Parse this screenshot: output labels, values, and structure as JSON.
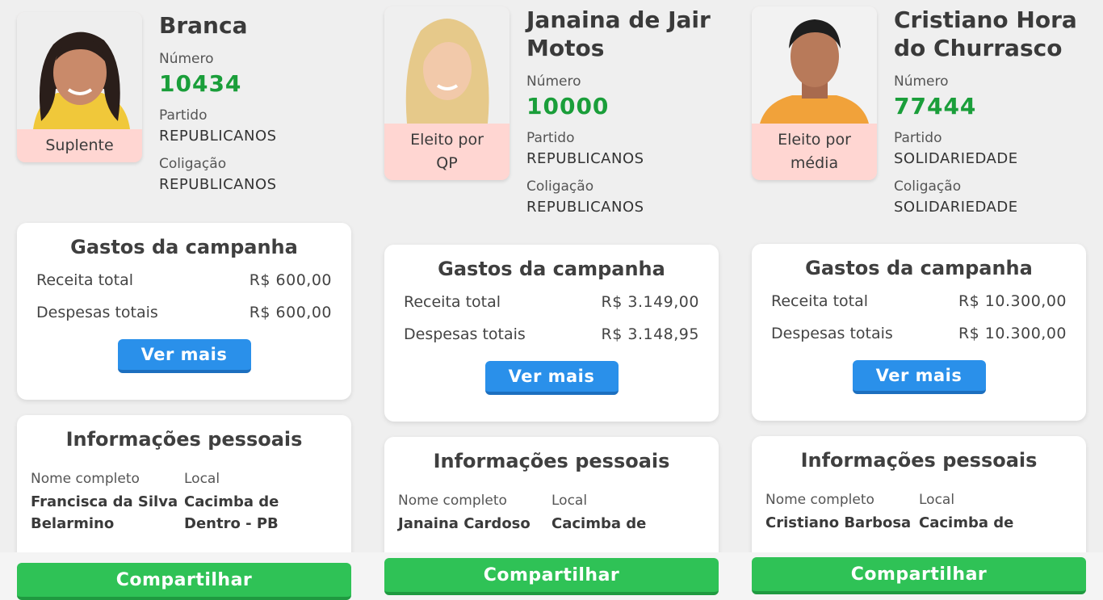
{
  "candidates": [
    {
      "name": "Branca",
      "status": "Suplente",
      "numero_label": "Número",
      "numero": "10434",
      "partido_label": "Partido",
      "partido": "REPUBLICANOS",
      "coligacao_label": "Coligação",
      "coligacao": "REPUBLICANOS",
      "gastos": {
        "title": "Gastos da campanha",
        "receita_label": "Receita total",
        "receita": "R$ 600,00",
        "despesas_label": "Despesas totais",
        "despesas": "R$ 600,00",
        "button": "Ver mais"
      },
      "pessoais": {
        "title": "Informações pessoais",
        "nome_label": "Nome completo",
        "nome": "Francisca da Silva\nBelarmino",
        "local_label": "Local",
        "local": "Cacimba de\nDentro - PB"
      },
      "share": "Compartilhar"
    },
    {
      "name": "Janaina de Jair\nMotos",
      "status": "Eleito por\nQP",
      "numero_label": "Número",
      "numero": "10000",
      "partido_label": "Partido",
      "partido": "REPUBLICANOS",
      "coligacao_label": "Coligação",
      "coligacao": "REPUBLICANOS",
      "gastos": {
        "title": "Gastos da campanha",
        "receita_label": "Receita total",
        "receita": "R$ 3.149,00",
        "despesas_label": "Despesas totais",
        "despesas": "R$ 3.148,95",
        "button": "Ver mais"
      },
      "pessoais": {
        "title": "Informações pessoais",
        "nome_label": "Nome completo",
        "nome": "Janaina Cardoso",
        "local_label": "Local",
        "local": "Cacimba de"
      },
      "share": "Compartilhar"
    },
    {
      "name": "Cristiano Hora\ndo Churrasco",
      "status": "Eleito por\nmédia",
      "numero_label": "Número",
      "numero": "77444",
      "partido_label": "Partido",
      "partido": "SOLIDARIEDADE",
      "coligacao_label": "Coligação",
      "coligacao": "SOLIDARIEDADE",
      "gastos": {
        "title": "Gastos da campanha",
        "receita_label": "Receita total",
        "receita": "R$ 10.300,00",
        "despesas_label": "Despesas totais",
        "despesas": "R$ 10.300,00",
        "button": "Ver mais"
      },
      "pessoais": {
        "title": "Informações pessoais",
        "nome_label": "Nome completo",
        "nome": "Cristiano Barbosa",
        "local_label": "Local",
        "local": "Cacimba de"
      },
      "share": "Compartilhar"
    }
  ],
  "colors": {
    "numero": "#1a9e3a",
    "ver_mais": "#2a90ea",
    "compartilhar": "#2fc256",
    "status_badge": "#ffd6d2"
  }
}
